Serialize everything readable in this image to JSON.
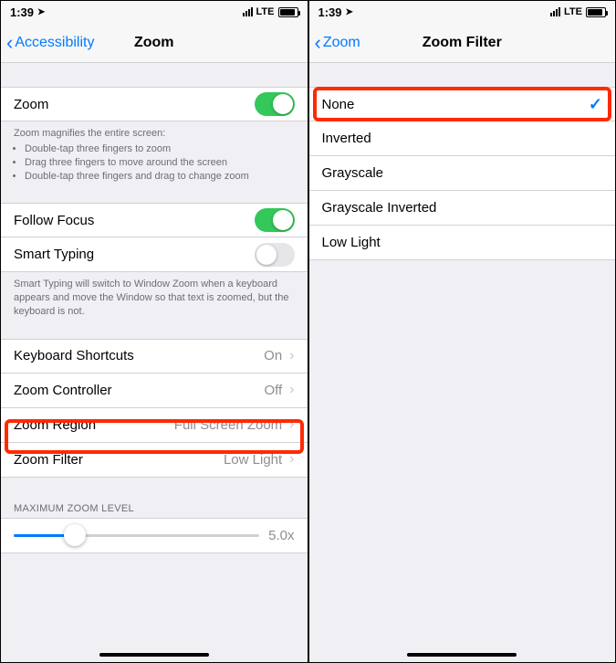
{
  "status": {
    "time": "1:39",
    "network": "LTE"
  },
  "left": {
    "back": "Accessibility",
    "title": "Zoom",
    "zoom_row": {
      "label": "Zoom",
      "on": true
    },
    "zoom_footer_title": "Zoom magnifies the entire screen:",
    "zoom_footer_items": [
      "Double-tap three fingers to zoom",
      "Drag three fingers to move around the screen",
      "Double-tap three fingers and drag to change zoom"
    ],
    "follow_focus": {
      "label": "Follow Focus",
      "on": true
    },
    "smart_typing": {
      "label": "Smart Typing",
      "on": false
    },
    "smart_footer": "Smart Typing will switch to Window Zoom when a keyboard appears and move the Window so that text is zoomed, but the keyboard is not.",
    "rows": [
      {
        "label": "Keyboard Shortcuts",
        "value": "On"
      },
      {
        "label": "Zoom Controller",
        "value": "Off"
      },
      {
        "label": "Zoom Region",
        "value": "Full Screen Zoom"
      },
      {
        "label": "Zoom Filter",
        "value": "Low Light"
      }
    ],
    "max_header": "MAXIMUM ZOOM LEVEL",
    "max_value": "5.0x",
    "slider_percent": 25
  },
  "right": {
    "back": "Zoom",
    "title": "Zoom Filter",
    "options": [
      {
        "label": "None",
        "selected": true
      },
      {
        "label": "Inverted",
        "selected": false
      },
      {
        "label": "Grayscale",
        "selected": false
      },
      {
        "label": "Grayscale Inverted",
        "selected": false
      },
      {
        "label": "Low Light",
        "selected": false
      }
    ]
  }
}
